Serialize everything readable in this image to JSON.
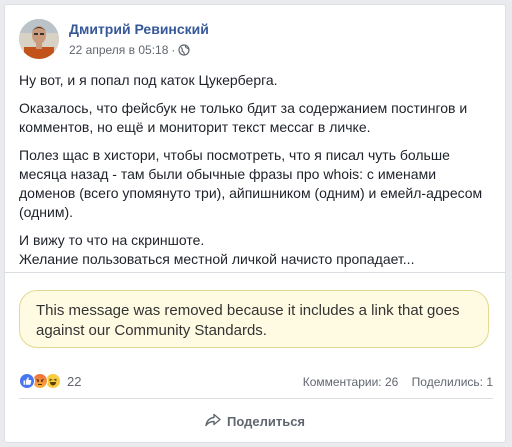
{
  "post": {
    "author": "Дмитрий Ревинский",
    "timestamp": "22 апреля в 05:18",
    "separator": "·",
    "privacy_icon": "globe-icon",
    "paragraphs": [
      "Ну вот, и я попал под каток Цукерберга.",
      "Оказалось, что фейсбук не только бдит за содержанием постингов и комментов, но ещё и мониторит текст мессаг в личке.",
      "Полез щас в хистори, чтобы посмотреть, что я писал чуть больше месяца назад - там были обычные фразы про whois: с именами доменов (всего упомянуто три), айпишником (одним) и емейл-адресом (одним).",
      "И вижу то что на скриншоте.\nЖелание пользоваться местной личкой начисто пропадает..."
    ]
  },
  "notice": {
    "text": "This message was removed because it includes a link that goes against our Community Standards."
  },
  "stats": {
    "reaction_icons": [
      "like-icon",
      "angry-icon",
      "haha-icon"
    ],
    "reaction_count": "22",
    "comments": "Комментарии: 26",
    "shares": "Поделились: 1"
  },
  "actions": {
    "share_label": "Поделиться",
    "share_icon": "share-arrow-icon"
  },
  "colors": {
    "author_link": "#365899",
    "notice_bg": "#fffbe3",
    "notice_border": "#e2d991",
    "like_blue": "#4876f2"
  }
}
